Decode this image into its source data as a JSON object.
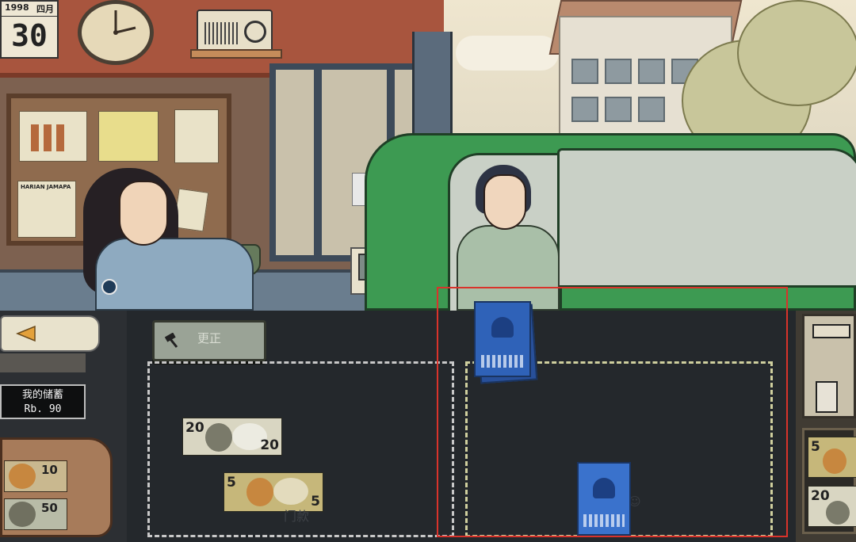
{
  "scene": {
    "calendar": {
      "year": "1998",
      "month": "四月",
      "day": "30"
    },
    "newspaper_title": "HARIAN JAMAPA"
  },
  "toolbar": {
    "correct_label": "更正"
  },
  "savings": {
    "label": "我的储蓄",
    "amount": "Rb. 90"
  },
  "wallet": {
    "notes": [
      {
        "value": "10"
      },
      {
        "value": "50"
      }
    ]
  },
  "counter": {
    "bills": [
      {
        "value": "20",
        "value_b": "20"
      },
      {
        "value": "5",
        "value_b": "5"
      }
    ],
    "faded_label": "门款"
  },
  "cash_drawer": {
    "notes": [
      {
        "value": "5"
      },
      {
        "value": "20"
      }
    ]
  },
  "colors": {
    "highlight": "#d9332b",
    "passbook": "#2f62b8",
    "car": "#3d9a52",
    "tray": "#24282c"
  }
}
